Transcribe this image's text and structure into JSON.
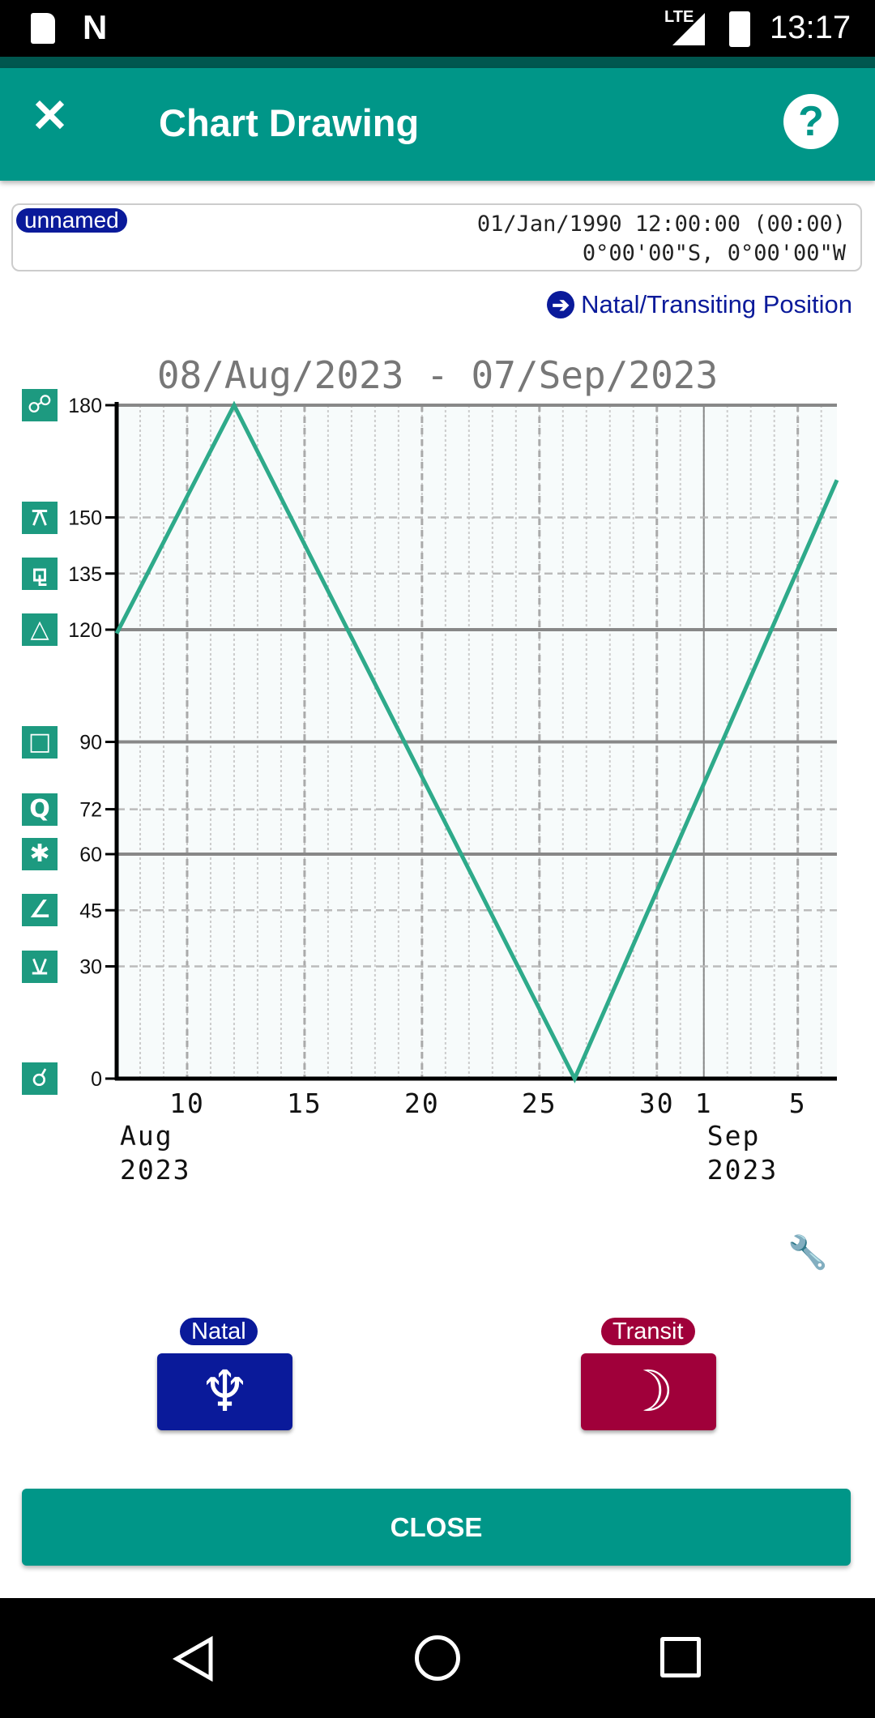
{
  "status_bar": {
    "time": "13:17",
    "network": "LTE",
    "icons": [
      "sd-card-icon",
      "n-icon",
      "signal-icon",
      "battery-icon"
    ]
  },
  "app_bar": {
    "title": "Chart Drawing",
    "close_icon": "close-icon",
    "help_icon": "help-icon"
  },
  "info": {
    "name_badge": "unnamed",
    "datetime": "01/Jan/1990 12:00:00 (00:00)",
    "location": "0°00'00\"S, 0°00'00\"W"
  },
  "link": {
    "label": "Natal/Transiting Position",
    "icon": "arrow-right-circle-icon"
  },
  "chart_data": {
    "type": "line",
    "title": "08/Aug/2023 - 07/Sep/2023",
    "xlim": [
      "2023-08-07T00:00",
      "2023-09-06T16:00"
    ],
    "ylim": [
      0,
      180
    ],
    "grid": true,
    "color": "#2eaa8a",
    "points": [
      {
        "x": "2023-08-07T00:00",
        "y": 119
      },
      {
        "x": "2023-08-12T00:00",
        "y": 180
      },
      {
        "x": "2023-08-26T12:00",
        "y": 0
      },
      {
        "x": "2023-09-06T16:00",
        "y": 160
      }
    ],
    "y_ticks": [
      {
        "value": 0,
        "label": "0",
        "major": true,
        "aspect": "conjunction",
        "glyph": "☌"
      },
      {
        "value": 30,
        "label": "30",
        "major": false,
        "aspect": "semisextile",
        "glyph": "⚺"
      },
      {
        "value": 45,
        "label": "45",
        "major": false,
        "aspect": "semisquare",
        "glyph": "∠"
      },
      {
        "value": 60,
        "label": "60",
        "major": true,
        "aspect": "sextile",
        "glyph": "✱"
      },
      {
        "value": 72,
        "label": "72",
        "major": false,
        "aspect": "quintile",
        "glyph": "Q"
      },
      {
        "value": 90,
        "label": "90",
        "major": true,
        "aspect": "square",
        "glyph": "□"
      },
      {
        "value": 120,
        "label": "120",
        "major": true,
        "aspect": "trine",
        "glyph": "△"
      },
      {
        "value": 135,
        "label": "135",
        "major": false,
        "aspect": "sesquiquadrate",
        "glyph": "⚼"
      },
      {
        "value": 150,
        "label": "150",
        "major": false,
        "aspect": "quincunx",
        "glyph": "⚻"
      },
      {
        "value": 180,
        "label": "180",
        "major": true,
        "aspect": "opposition",
        "glyph": "☍"
      }
    ],
    "x_ticks": [
      {
        "date": "2023-08-10",
        "label": "10"
      },
      {
        "date": "2023-08-15",
        "label": "15"
      },
      {
        "date": "2023-08-20",
        "label": "20"
      },
      {
        "date": "2023-08-25",
        "label": "25"
      },
      {
        "date": "2023-08-30",
        "label": "30"
      },
      {
        "date": "2023-09-01",
        "label": "1",
        "month_start": true
      },
      {
        "date": "2023-09-05",
        "label": "5"
      }
    ],
    "month_labels": [
      {
        "date": "2023-08-07",
        "month": "Aug",
        "year": "2023"
      },
      {
        "date": "2023-09-01",
        "month": "Sep",
        "year": "2023"
      }
    ]
  },
  "settings_icon": "wrench-icon",
  "natal": {
    "label": "Natal",
    "planet": "Neptune",
    "glyph": "♆",
    "color": "#0a1a9a"
  },
  "transit": {
    "label": "Transit",
    "planet": "Moon",
    "glyph": "☽",
    "color": "#a0003a"
  },
  "close_button": "CLOSE",
  "nav": [
    "back-icon",
    "home-icon",
    "recents-icon"
  ]
}
